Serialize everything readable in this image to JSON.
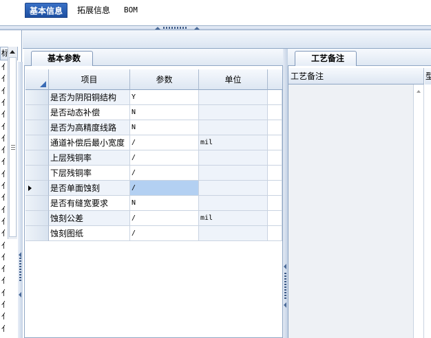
{
  "tabs": [
    {
      "label": "基本信息",
      "active": true
    },
    {
      "label": "拓展信息",
      "active": false
    },
    {
      "label": "BOM",
      "active": false
    }
  ],
  "left_strip": {
    "header": "标",
    "row_chars": [
      "亻",
      "亻",
      "亻",
      "亻",
      "亻",
      "亻",
      "亻",
      "亻",
      "亻",
      "亻",
      "亻",
      "亻",
      "亻",
      "亻",
      "亻",
      "亻",
      "亻",
      "亻",
      "亻",
      "亻",
      "亻",
      "亻",
      "亻"
    ]
  },
  "basic_params": {
    "tab_label": "基本参数",
    "columns": [
      "项目",
      "参数",
      "单位"
    ],
    "rows": [
      {
        "item": "是否为阴阳铜结构",
        "param": "Y",
        "unit": ""
      },
      {
        "item": "是否动态补偿",
        "param": "N",
        "unit": ""
      },
      {
        "item": "是否为高精度线路",
        "param": "N",
        "unit": ""
      },
      {
        "item": "通道补偿后最小宽度",
        "param": "/",
        "unit": "mil"
      },
      {
        "item": "上层残铜率",
        "param": "/",
        "unit": ""
      },
      {
        "item": "下层残铜率",
        "param": "/",
        "unit": ""
      },
      {
        "item": "是否单面蚀刻",
        "param": "/",
        "unit": ""
      },
      {
        "item": "是否有缝宽要求",
        "param": "N",
        "unit": ""
      },
      {
        "item": "蚀刻公差",
        "param": "/",
        "unit": "mil"
      },
      {
        "item": "蚀刻图纸",
        "param": "/",
        "unit": ""
      }
    ],
    "current_row_index": 6
  },
  "process_notes": {
    "tab_label": "工艺备注",
    "column": "工艺备注",
    "column2_partial": "型"
  },
  "colors": {
    "active_tab": "#2a5fb5",
    "selected_cell": "#b3d0f2",
    "alt_row": "#eef3fa",
    "border": "#8fa6c4"
  }
}
